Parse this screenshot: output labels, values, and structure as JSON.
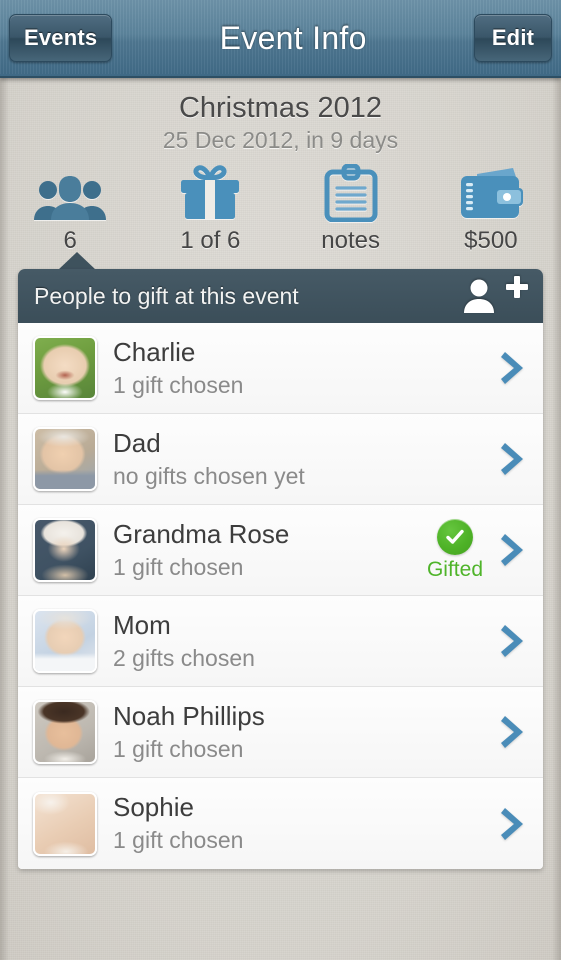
{
  "navbar": {
    "back_label": "Events",
    "title": "Event Info",
    "edit_label": "Edit"
  },
  "event": {
    "title": "Christmas 2012",
    "subtitle": "25 Dec 2012, in 9 days"
  },
  "stats": [
    {
      "icon": "people-icon",
      "value": "6"
    },
    {
      "icon": "gift-icon",
      "value": "1 of 6"
    },
    {
      "icon": "notes-icon",
      "value": "notes"
    },
    {
      "icon": "wallet-icon",
      "value": "$500"
    }
  ],
  "panel": {
    "header_label": "People to gift at this event",
    "add_icon": "add-person-icon"
  },
  "people": [
    {
      "name": "Charlie",
      "status": "1 gift chosen",
      "gifted": false,
      "avatar": "baby laughing outdoors",
      "avatar_colors": [
        "#6f9e3f",
        "#e8cdb0",
        "#9dbd62"
      ]
    },
    {
      "name": "Dad",
      "status": "no gifts chosen yet",
      "gifted": false,
      "avatar": "older man smiling",
      "avatar_colors": [
        "#b9ab96",
        "#e3c4a6",
        "#8d98a6"
      ]
    },
    {
      "name": "Grandma Rose",
      "status": "1 gift chosen",
      "gifted": true,
      "gifted_label": "Gifted",
      "avatar": "elderly woman with white hair",
      "avatar_colors": [
        "#3f5263",
        "#ece7e1",
        "#c9b49c"
      ]
    },
    {
      "name": "Mom",
      "status": "2 gifts chosen",
      "gifted": false,
      "avatar": "woman with grey hair smiling",
      "avatar_colors": [
        "#c3d2e2",
        "#e7cdb3",
        "#d8dde6"
      ]
    },
    {
      "name": "Noah Phillips",
      "status": "1 gift chosen",
      "gifted": false,
      "avatar": "teenage boy with dark hair",
      "avatar_colors": [
        "#3b2a20",
        "#e0b795",
        "#d9d4cc"
      ]
    },
    {
      "name": "Sophie",
      "status": "1 gift chosen",
      "gifted": false,
      "avatar": "girl wearing large sunglasses",
      "avatar_colors": [
        "#e9cdb4",
        "#4a3026",
        "#f0e6dc"
      ]
    }
  ],
  "colors": {
    "nav_blue": "#4e7690",
    "icon_blue": "#4a90bb",
    "icon_teal": "#3e6f8c",
    "panel_dark": "#3f525d",
    "chevron_blue": "#4a8cb8",
    "gifted_green": "#4fb42a",
    "background": "#d8d5cf"
  }
}
